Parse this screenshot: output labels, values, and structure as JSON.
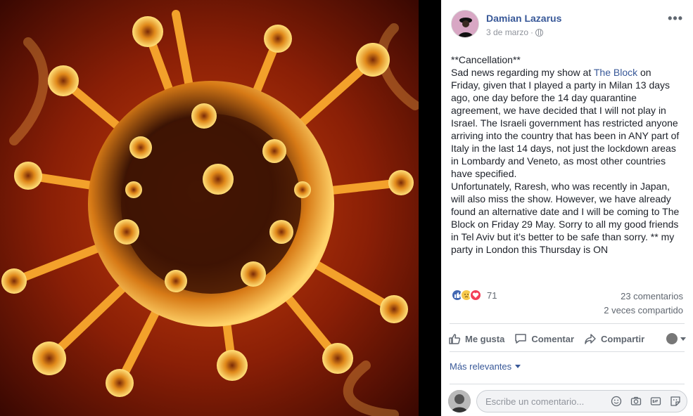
{
  "post": {
    "author": "Damian Lazarus",
    "date": "3 de marzo",
    "dot": "·",
    "more_label": "•••",
    "body": {
      "line1": "**Cancellation**",
      "part_a": "Sad news regarding my show at ",
      "link_text": "The Block",
      "part_b": " on Friday, given that I played a party in Milan 13 days ago, one day before the 14 day quarantine agreement, we have decided that I will not play in Israel. The Israeli government has restricted anyone arriving into the country that has been in ANY part of Italy in the last 14 days, not just the lockdown areas in Lombardy and Veneto, as most other countries have specified.",
      "para2": "Unfortunately, Raresh, who was recently in Japan, will also miss the show. However, we have already found an alternative date and I will be coming to The Block on Friday 29 May. Sorry to all my good friends in Tel Aviv but it’s better to be safe than sorry. ** my party in London this Thursday is ON"
    }
  },
  "reactions": {
    "count": "71",
    "comments": "23 comentarios",
    "shares": "2 veces compartido"
  },
  "actions": {
    "like": "Me gusta",
    "comment": "Comentar",
    "share": "Compartir"
  },
  "sort": {
    "label": "Más relevantes"
  },
  "composer": {
    "placeholder": "Escribe un comentario..."
  },
  "colors": {
    "link": "#385898",
    "like": "#4267b2",
    "love": "#f33e58",
    "sad": "#f7c94b"
  },
  "icons": [
    "globe-icon",
    "more-icon",
    "like-icon",
    "comment-icon",
    "share-icon",
    "emoji-icon",
    "camera-icon",
    "gif-icon",
    "sticker-icon"
  ]
}
